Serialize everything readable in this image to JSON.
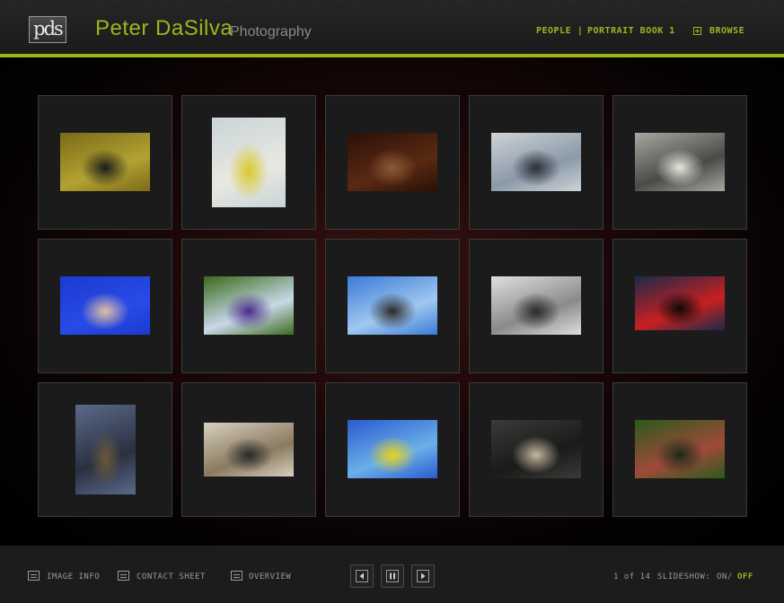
{
  "brand": {
    "logo_text": "pds",
    "name": "Peter DaSilva",
    "subtitle": "Photography"
  },
  "breadcrumb": {
    "section": "PEOPLE",
    "separator": "|",
    "gallery": "PORTRAIT BOOK 1"
  },
  "header": {
    "browse_label": "BROWSE"
  },
  "thumbnails": [
    {
      "label": "portrait-round-window",
      "colors": [
        "#7a6a18",
        "#b3a232",
        "#1a1a1a"
      ]
    },
    {
      "label": "two-men-on-couch-birds",
      "colors": [
        "#c9d4d8",
        "#e8e8e0",
        "#d8c828"
      ]
    },
    {
      "label": "dark-interior-man",
      "colors": [
        "#2a1008",
        "#5a2a12",
        "#8a5a3a"
      ]
    },
    {
      "label": "three-men-corridor",
      "colors": [
        "#cfd3d6",
        "#8a9aa8",
        "#2a2f38"
      ]
    },
    {
      "label": "man-with-machine",
      "colors": [
        "#a8a8a0",
        "#4a4a48",
        "#e8e8e0"
      ]
    },
    {
      "label": "woman-blue-room",
      "colors": [
        "#1a3ad0",
        "#2a4ae8",
        "#e0c0a0"
      ]
    },
    {
      "label": "man-toy-story-figures",
      "colors": [
        "#3a6a1a",
        "#c8d8e8",
        "#4a2a8a"
      ]
    },
    {
      "label": "cowboy-blue-sky",
      "colors": [
        "#3a7ad8",
        "#a0c8f0",
        "#2a2a2a"
      ]
    },
    {
      "label": "man-hard-hat-angles",
      "colors": [
        "#e0e0e0",
        "#8a8a8a",
        "#2a2a2a"
      ]
    },
    {
      "label": "man-control-room",
      "colors": [
        "#1a2a4a",
        "#c82020",
        "#0a0a0a"
      ]
    },
    {
      "label": "man-on-rocks-dusk",
      "colors": [
        "#5a6a8a",
        "#2a3040",
        "#6a5a3a"
      ]
    },
    {
      "label": "woman-white-room",
      "colors": [
        "#d8d0c0",
        "#8a7a60",
        "#2a2a2a"
      ]
    },
    {
      "label": "yellow-bugatti",
      "colors": [
        "#2a5ad0",
        "#6ab0e8",
        "#e8d020"
      ]
    },
    {
      "label": "man-chalkboard",
      "colors": [
        "#3a3a38",
        "#1a1a18",
        "#c8b8a0"
      ]
    },
    {
      "label": "man-in-bamboo",
      "colors": [
        "#2a5a1a",
        "#a04a3a",
        "#1a2a1a"
      ]
    }
  ],
  "footer": {
    "image_info": "IMAGE INFO",
    "contact_sheet": "CONTACT SHEET",
    "overview": "OVERVIEW",
    "counter": "1 of 14",
    "slideshow_label": "SLIDESHOW:",
    "slideshow_on": "ON/",
    "slideshow_off": "OFF"
  },
  "colors": {
    "accent": "#9bb520",
    "header_bg": "#1f1f1f",
    "tile_bg": "#1b1b1b",
    "stage_glow": "#3a1212"
  }
}
